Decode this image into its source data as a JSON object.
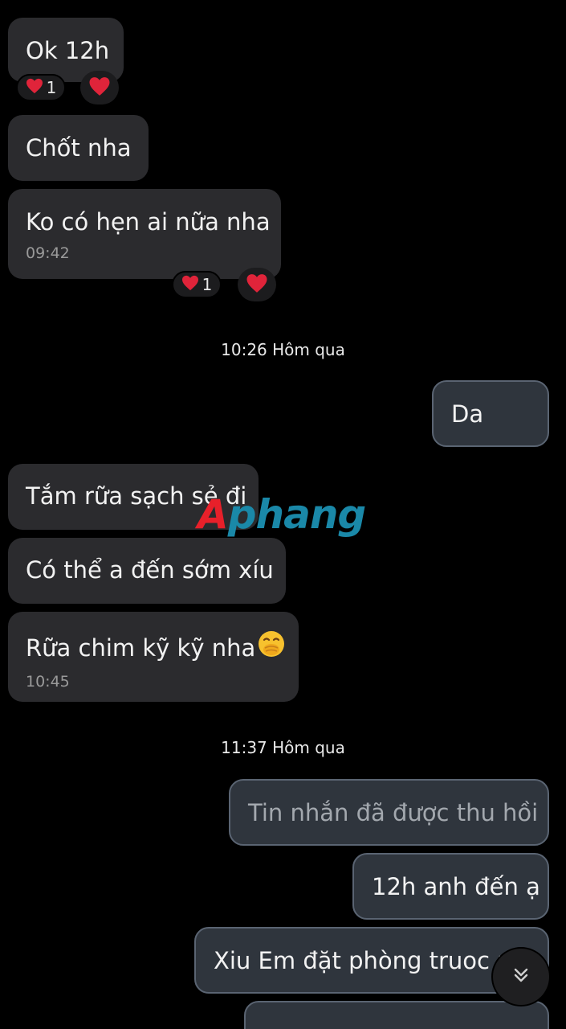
{
  "messages": {
    "m1": {
      "text": "Ok 12h"
    },
    "m1_reactions": {
      "count": "1"
    },
    "m2": {
      "text": "Chốt nha"
    },
    "m3": {
      "text": "Ko có hẹn ai nữa nha",
      "time": "09:42"
    },
    "m3_reactions": {
      "count": "1"
    },
    "divider1": "10:26 Hôm qua",
    "m4": {
      "text": "Da"
    },
    "m5": {
      "text": "Tắm rữa sạch sẻ đi"
    },
    "m6": {
      "text": "Có thể a đến sớm xíu"
    },
    "m7": {
      "text": "Rữa chim kỹ kỹ nha",
      "time": "10:45"
    },
    "divider2": "11:37 Hôm qua",
    "m8": {
      "text": "Tin nhắn đã được thu hồi"
    },
    "m9": {
      "text": "12h anh đến ạ"
    },
    "m10": {
      "text": "Xiu Em đặt phòng truoc n"
    }
  },
  "watermark": {
    "part1": "A",
    "part2": "phang"
  },
  "icons": {
    "heart": "heart-icon",
    "emoji": "hand-over-mouth-emoji-icon",
    "scroll": "chevron-double-down-icon"
  },
  "colors": {
    "background": "#000000",
    "incoming_bubble": "#2b2b2e",
    "outgoing_bubble": "#2f353d",
    "heart": "#e0243a",
    "watermark_red": "#e8202a",
    "watermark_teal": "#1a88a8"
  }
}
